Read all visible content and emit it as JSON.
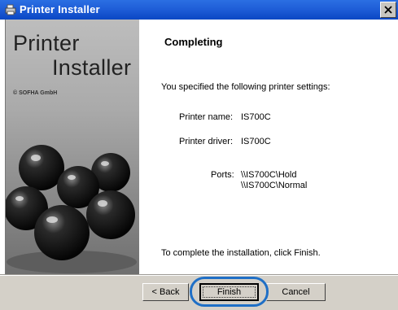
{
  "window": {
    "title": "Printer Installer"
  },
  "brand": {
    "line1": "Printer",
    "line2": "Installer",
    "copyright": "© SOFHA GmbH"
  },
  "content": {
    "heading": "Completing",
    "intro": "You specified the following printer settings:",
    "printer_name_label": "Printer name:",
    "printer_name_value": "IS700C",
    "printer_driver_label": "Printer driver:",
    "printer_driver_value": "IS700C",
    "ports_label": "Ports:",
    "ports": [
      "\\\\IS700C\\Hold",
      "\\\\IS700C\\Normal"
    ],
    "footer": "To complete the installation, click Finish."
  },
  "buttons": {
    "back": "< Back",
    "finish": "Finish",
    "cancel": "Cancel"
  },
  "colors": {
    "title_bar": "#0a47c4",
    "highlight": "#1f6fc6",
    "dialog_face": "#d4d0c8"
  }
}
